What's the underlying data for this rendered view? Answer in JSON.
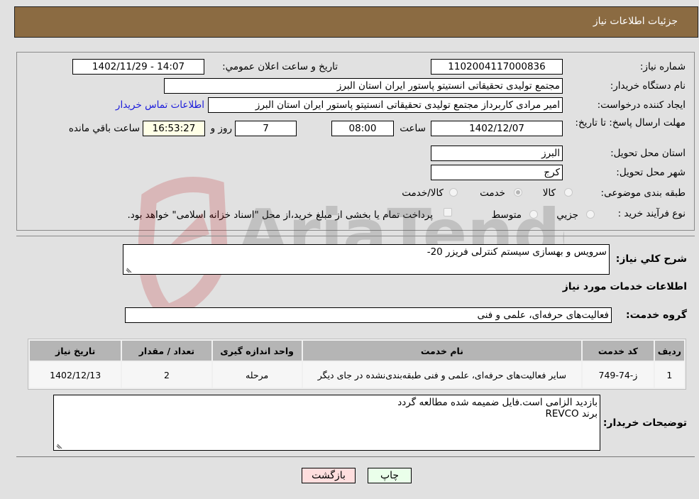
{
  "header": {
    "title": "جزئیات اطلاعات نیاز"
  },
  "form": {
    "need_number": {
      "label": "شماره نیاز:",
      "value": "1102004117000836"
    },
    "announce_datetime": {
      "label": "تاریخ و ساعت اعلان عمومي:",
      "value": "1402/11/29 - 14:07"
    },
    "buyer_org": {
      "label": "نام دستگاه خریدار:",
      "value": "مجتمع تولیدی تحقیقاتی انستیتو پاستور ایران استان البرز"
    },
    "requester": {
      "label": "ایجاد کننده درخواست:",
      "value": "امیر مرادی کاربرداز مجتمع تولیدی تحقیقاتی انستیتو پاستور ایران استان البرز"
    },
    "buyer_contact_link": "اطلاعات تماس خریدار",
    "deadline": {
      "label": "مهلت ارسال پاسخ: تا تاریخ:",
      "date": "1402/12/07",
      "time_label": "ساعت",
      "time": "08:00",
      "days": "7",
      "days_label": "روز و",
      "remaining": "16:53:27",
      "remaining_label": "ساعت باقي مانده"
    },
    "delivery_province": {
      "label": "استان محل تحویل:",
      "value": "البرز"
    },
    "delivery_city": {
      "label": "شهر محل تحویل:",
      "value": "کرج"
    },
    "category": {
      "label": "طبقه بندی موضوعی:",
      "options": [
        {
          "label": "کالا",
          "checked": false
        },
        {
          "label": "خدمت",
          "checked": true
        },
        {
          "label": "کالا/خدمت",
          "checked": false
        }
      ]
    },
    "purchase_type": {
      "label": "نوع فرآیند خرید :",
      "options": [
        {
          "label": "جزيي",
          "checked": false
        },
        {
          "label": "متوسط",
          "checked": false
        }
      ],
      "treasury_note": "پرداخت تمام یا بخشی از مبلغ خرید،از محل \"اسناد خزانه اسلامی\" خواهد بود."
    }
  },
  "description": {
    "label": "شرح کلي نياز:",
    "value": "سرویس و بهسازی سیستم کنترلی فریزر 20-"
  },
  "services_section": {
    "title": "اطلاعات خدمات مورد نیاز"
  },
  "service_group": {
    "label": "گروه خدمت:",
    "value": "فعالیت‌های حرفه‌ای، علمی و فنی"
  },
  "table": {
    "headers": [
      "ردیف",
      "کد خدمت",
      "نام خدمت",
      "واحد اندازه گیری",
      "تعداد / مقدار",
      "تاریخ نیاز"
    ],
    "rows": [
      [
        "1",
        "ز-74-749",
        "سایر فعالیت‌های حرفه‌ای، علمی و فنی طبقه‌بندی‌نشده در جای دیگر",
        "مرحله",
        "2",
        "1402/12/13"
      ]
    ]
  },
  "buyer_notes": {
    "label": "توضیحات خریدار:",
    "lines": [
      "بازدید الزامی است.فایل ضمیمه شده مطالعه گردد",
      "برند REVCO"
    ]
  },
  "buttons": {
    "print": "چاپ",
    "back": "بازگشت"
  },
  "colors": {
    "header_bg": "#8b6b42",
    "print_bg": "#eaffea",
    "back_bg": "#ffdede",
    "link": "#1a1adb"
  },
  "watermark": {
    "text": "AriaTender.neT"
  }
}
